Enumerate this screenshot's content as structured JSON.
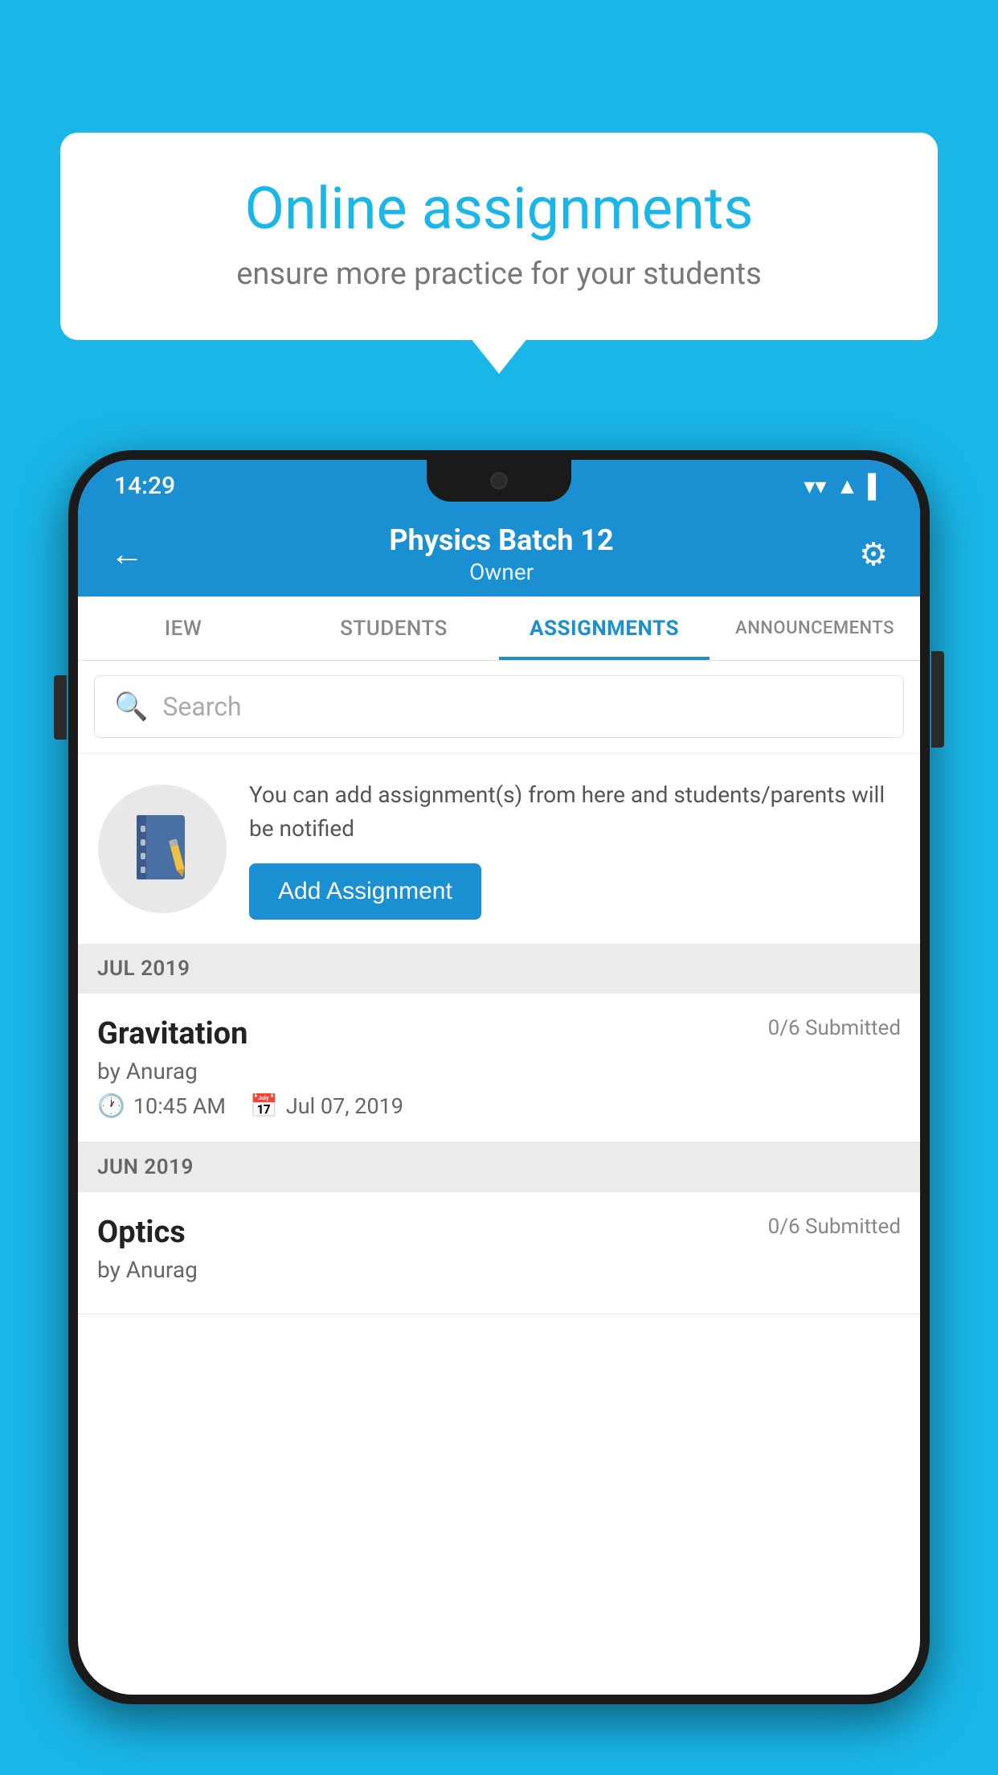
{
  "background_color": "#1ab6e8",
  "speech_bubble": {
    "title": "Online assignments",
    "subtitle": "ensure more practice for your students"
  },
  "status_bar": {
    "time": "14:29",
    "wifi": "▼",
    "signal": "▲",
    "battery": "▌"
  },
  "app_header": {
    "title": "Physics Batch 12",
    "subtitle": "Owner",
    "back_label": "←",
    "settings_label": "⚙"
  },
  "tabs": [
    {
      "label": "IEW",
      "active": false
    },
    {
      "label": "STUDENTS",
      "active": false
    },
    {
      "label": "ASSIGNMENTS",
      "active": true
    },
    {
      "label": "ANNOUNCEMENTS",
      "active": false
    }
  ],
  "search": {
    "placeholder": "Search"
  },
  "add_assignment": {
    "info_text": "You can add assignment(s) from here and students/parents will be notified",
    "button_label": "Add Assignment"
  },
  "sections": [
    {
      "label": "JUL 2019",
      "assignments": [
        {
          "name": "Gravitation",
          "submitted": "0/6 Submitted",
          "by": "by Anurag",
          "time": "10:45 AM",
          "date": "Jul 07, 2019"
        }
      ]
    },
    {
      "label": "JUN 2019",
      "assignments": [
        {
          "name": "Optics",
          "submitted": "0/6 Submitted",
          "by": "by Anurag",
          "time": "",
          "date": ""
        }
      ]
    }
  ]
}
